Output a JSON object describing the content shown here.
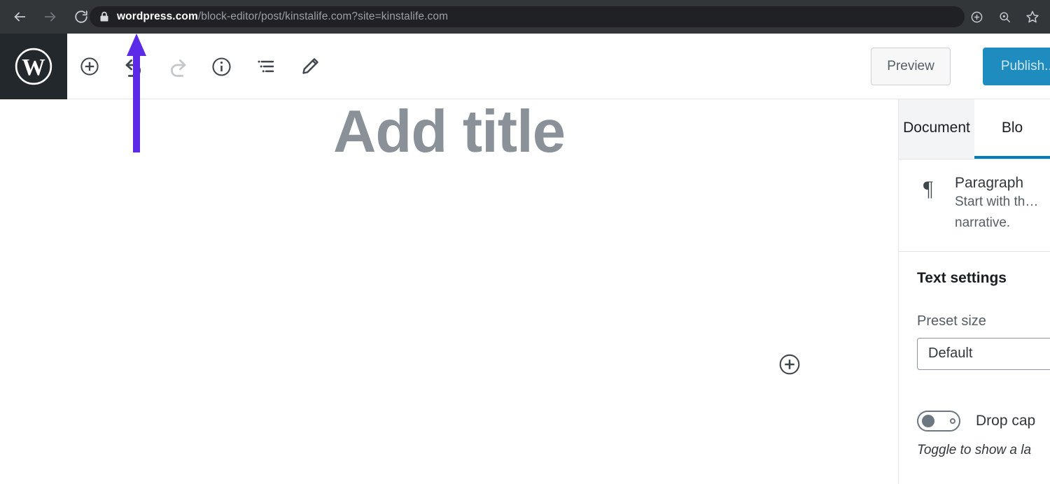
{
  "browser": {
    "back_icon": "arrow-left-icon",
    "forward_icon": "arrow-right-icon",
    "reload_icon": "reload-icon",
    "lock_icon": "lock-icon",
    "url_host": "wordpress.com",
    "url_path": "/block-editor/post/kinstalife.com?site=kinstalife.com",
    "url_full": "wordpress.com/block-editor/post/kinstalife.com?site=kinstalife.com",
    "right_icons": [
      "install-app-icon",
      "zoom-search-icon",
      "bookmark-star-icon"
    ]
  },
  "editor_header": {
    "logo": "wordpress-logo-icon",
    "tools": [
      {
        "name": "add-block-button",
        "icon": "plus-circle-icon",
        "disabled": false
      },
      {
        "name": "undo-button",
        "icon": "undo-arrow-icon",
        "disabled": false
      },
      {
        "name": "redo-button",
        "icon": "redo-arrow-icon",
        "disabled": true
      },
      {
        "name": "content-info-button",
        "icon": "info-circle-icon",
        "disabled": false
      },
      {
        "name": "block-navigation-button",
        "icon": "list-view-icon",
        "disabled": false
      },
      {
        "name": "edit-mode-button",
        "icon": "pencil-icon",
        "disabled": false
      }
    ],
    "preview_label": "Preview",
    "publish_label": "Publish...",
    "publish_color": "#1e8cbe"
  },
  "canvas": {
    "title_placeholder": "Add title",
    "inserter_icon": "plus-circle-icon"
  },
  "sidebar": {
    "tabs": [
      {
        "label": "Document",
        "active": false
      },
      {
        "label": "Blo",
        "active": true
      }
    ],
    "active_tab_color": "#007cba",
    "block_card": {
      "icon": "paragraph-pilcrow-icon",
      "title": "Paragraph",
      "description": "Start with th… narrative."
    },
    "text_settings": {
      "panel_title": "Text settings",
      "preset_size_label": "Preset size",
      "preset_size_value": "Default",
      "drop_cap_label": "Drop cap",
      "drop_cap_state": "off",
      "drop_cap_help": "Toggle to show a la"
    }
  },
  "annotation": {
    "arrow": "up-arrow-annotation",
    "color": "#5b2be8"
  }
}
